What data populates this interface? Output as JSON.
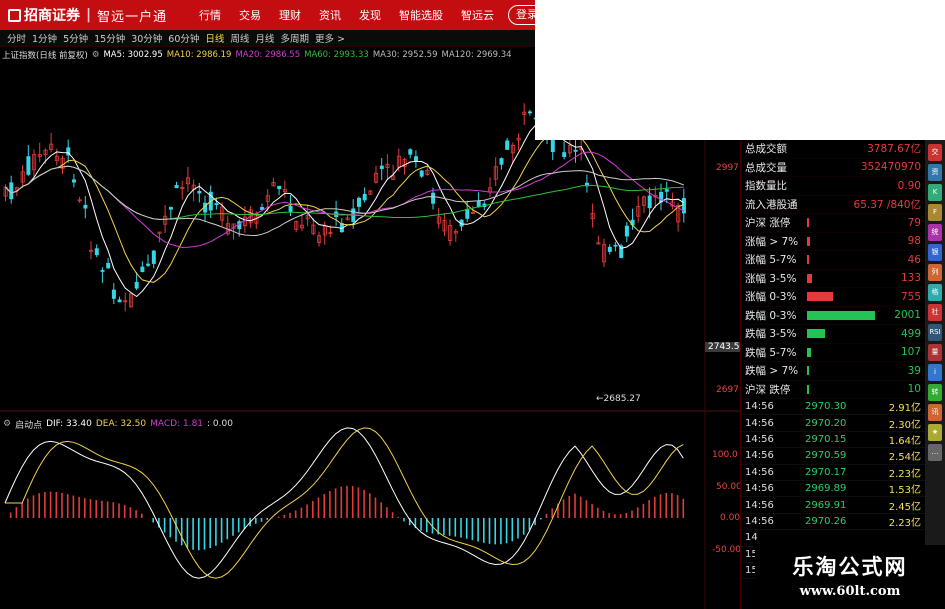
{
  "app": {
    "brand": "招商证券",
    "slogan": "智远一户通"
  },
  "nav": [
    "行情",
    "交易",
    "理财",
    "资讯",
    "发现",
    "智能选股",
    "智远云"
  ],
  "login": {
    "label": "登录"
  },
  "periods": [
    "分时",
    "1分钟",
    "5分钟",
    "15分钟",
    "30分钟",
    "60分钟",
    "日线",
    "周线",
    "月线",
    "多周期",
    "更多 >"
  ],
  "active_period": "日线",
  "chart_title": "上证指数(日线 前复权)",
  "ma_lines": [
    {
      "label": "MA5: 3002.95",
      "color": "#ffffff"
    },
    {
      "label": "MA10: 2986.19",
      "color": "#f1d24a"
    },
    {
      "label": "MA20: 2986.55",
      "color": "#d23ad2"
    },
    {
      "label": "MA60: 2993.33",
      "color": "#2fbf3a"
    },
    {
      "label": "MA30: 2952.59",
      "color": "#bbbbbb"
    },
    {
      "label": "MA120: 2969.34",
      "color": "#bbbbbb"
    }
  ],
  "price_scale": {
    "p1": "2997",
    "p2": "2743.5",
    "p3": "2697"
  },
  "low_marker": "2685.27",
  "macd": {
    "name": "启动点",
    "dif": "DIF: 33.40",
    "dea": "DEA: 32.50",
    "macd": "MACD: 1.81",
    "extra": ": 0.00",
    "scale": [
      "100.0",
      "50.00",
      "0.00",
      "-50.00"
    ]
  },
  "stats": [
    {
      "label": "总成交额",
      "value": "3787.67亿"
    },
    {
      "label": "总成交量",
      "value": "352470970"
    },
    {
      "label": "指数量比",
      "value": "0.90"
    },
    {
      "label": "流入港股通",
      "value": "65.37 /840亿"
    }
  ],
  "breadth": [
    {
      "label": "沪深 涨停",
      "value": "79",
      "fill": 0.03,
      "color": "#e23b3b"
    },
    {
      "label": "涨幅 > 7%",
      "value": "98",
      "fill": 0.04,
      "color": "#e23b3b"
    },
    {
      "label": "涨幅 5-7%",
      "value": "46",
      "fill": 0.02,
      "color": "#e23b3b"
    },
    {
      "label": "涨幅 3-5%",
      "value": "133",
      "fill": 0.06,
      "color": "#e23b3b"
    },
    {
      "label": "涨幅 0-3%",
      "value": "755",
      "fill": 0.33,
      "color": "#e23b3b"
    },
    {
      "label": "跌幅 0-3%",
      "value": "2001",
      "fill": 0.85,
      "color": "#25c254"
    },
    {
      "label": "跌幅 3-5%",
      "value": "499",
      "fill": 0.22,
      "color": "#25c254"
    },
    {
      "label": "跌幅 5-7%",
      "value": "107",
      "fill": 0.05,
      "color": "#25c254"
    },
    {
      "label": "跌幅 > 7%",
      "value": "39",
      "fill": 0.02,
      "color": "#25c254"
    },
    {
      "label": "沪深 跌停",
      "value": "10",
      "fill": 0.01,
      "color": "#25c254"
    }
  ],
  "trades": [
    {
      "time": "14:56",
      "price": "2970.30",
      "vol": "2.91亿"
    },
    {
      "time": "14:56",
      "price": "2970.20",
      "vol": "2.30亿"
    },
    {
      "time": "14:56",
      "price": "2970.15",
      "vol": "1.64亿"
    },
    {
      "time": "14:56",
      "price": "2970.59",
      "vol": "2.54亿"
    },
    {
      "time": "14:56",
      "price": "2970.17",
      "vol": "2.23亿"
    },
    {
      "time": "14:56",
      "price": "2969.89",
      "vol": "1.53亿"
    },
    {
      "time": "14:56",
      "price": "2969.91",
      "vol": "2.45亿"
    },
    {
      "time": "14:56",
      "price": "2970.26",
      "vol": "2.23亿"
    },
    {
      "time": "14",
      "price": "",
      "vol": ""
    },
    {
      "time": "15",
      "price": "",
      "vol": ""
    },
    {
      "time": "15",
      "price": "",
      "vol": ""
    }
  ],
  "sidebar_icons": [
    {
      "name": "trade-icon",
      "glyph": "交",
      "color": "#c33"
    },
    {
      "name": "news-icon",
      "glyph": "资",
      "color": "#37a"
    },
    {
      "name": "chart-icon",
      "glyph": "K",
      "color": "#3a7"
    },
    {
      "name": "calc-icon",
      "glyph": "F",
      "color": "#a83"
    },
    {
      "name": "stats-icon",
      "glyph": "统",
      "color": "#a3a"
    },
    {
      "name": "bank-icon",
      "glyph": "银",
      "color": "#36c"
    },
    {
      "name": "list-icon",
      "glyph": "列",
      "color": "#c63"
    },
    {
      "name": "grid-icon",
      "glyph": "格",
      "color": "#3aa"
    },
    {
      "name": "bbs-icon",
      "glyph": "社",
      "color": "#c33"
    },
    {
      "name": "rsi-icon",
      "glyph": "RSI",
      "color": "#357"
    },
    {
      "name": "vol-icon",
      "glyph": "量",
      "color": "#a33"
    },
    {
      "name": "info-icon",
      "glyph": "i",
      "color": "#37c"
    },
    {
      "name": "swap-icon",
      "glyph": "转",
      "color": "#3a3"
    },
    {
      "name": "news2-icon",
      "glyph": "讯",
      "color": "#c63"
    },
    {
      "name": "star-icon",
      "glyph": "★",
      "color": "#aa3"
    },
    {
      "name": "more-icon",
      "glyph": "…",
      "color": "#666"
    }
  ],
  "watermark": {
    "line1": "乐淘公式网",
    "line2": "www.60lt.com"
  }
}
